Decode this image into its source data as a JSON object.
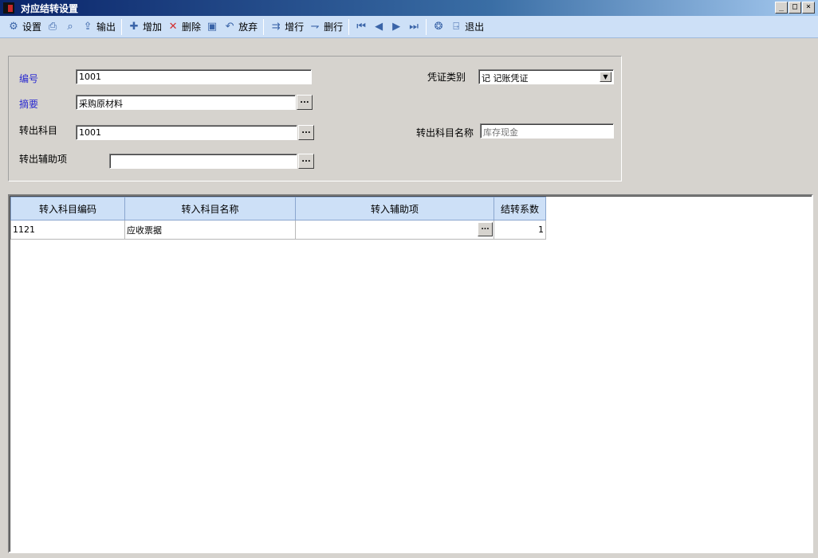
{
  "window": {
    "title": "对应结转设置",
    "controls": {
      "minimize": "_",
      "maximize": "□",
      "close": "×"
    }
  },
  "toolbar": {
    "items": [
      {
        "icon": "settings-icon",
        "label": "设置"
      },
      {
        "icon": "print-icon",
        "label": ""
      },
      {
        "icon": "preview-icon",
        "label": ""
      },
      {
        "icon": "export-icon",
        "label": "输出"
      },
      {
        "icon": "add-icon",
        "label": "增加"
      },
      {
        "icon": "delete-icon",
        "label": "删除"
      },
      {
        "icon": "save-icon",
        "label": ""
      },
      {
        "icon": "undo-icon",
        "label": "放弃"
      },
      {
        "icon": "insert-row-icon",
        "label": "增行"
      },
      {
        "icon": "delete-row-icon",
        "label": "删行"
      },
      {
        "icon": "first-record-icon",
        "label": ""
      },
      {
        "icon": "prev-record-icon",
        "label": ""
      },
      {
        "icon": "next-record-icon",
        "label": ""
      },
      {
        "icon": "last-record-icon",
        "label": ""
      },
      {
        "icon": "help-icon",
        "label": ""
      },
      {
        "icon": "exit-icon",
        "label": "退出"
      }
    ]
  },
  "form": {
    "number": {
      "label": "编号",
      "value": "1001"
    },
    "summary": {
      "label": "摘要",
      "value": "采购原材料"
    },
    "out_account": {
      "label": "转出科目",
      "value": "1001"
    },
    "out_aux": {
      "label": "转出辅助项",
      "value": ""
    },
    "voucher_type": {
      "label": "凭证类别",
      "value": "记 记账凭证"
    },
    "out_account_name": {
      "label": "转出科目名称",
      "value": "库存现金"
    },
    "ellipsis": "..."
  },
  "grid": {
    "headers": [
      "转入科目编码",
      "转入科目名称",
      "转入辅助项",
      "结转系数"
    ],
    "rows": [
      {
        "code": "1121",
        "name": "应收票据",
        "aux": "",
        "coef": "1"
      }
    ]
  }
}
